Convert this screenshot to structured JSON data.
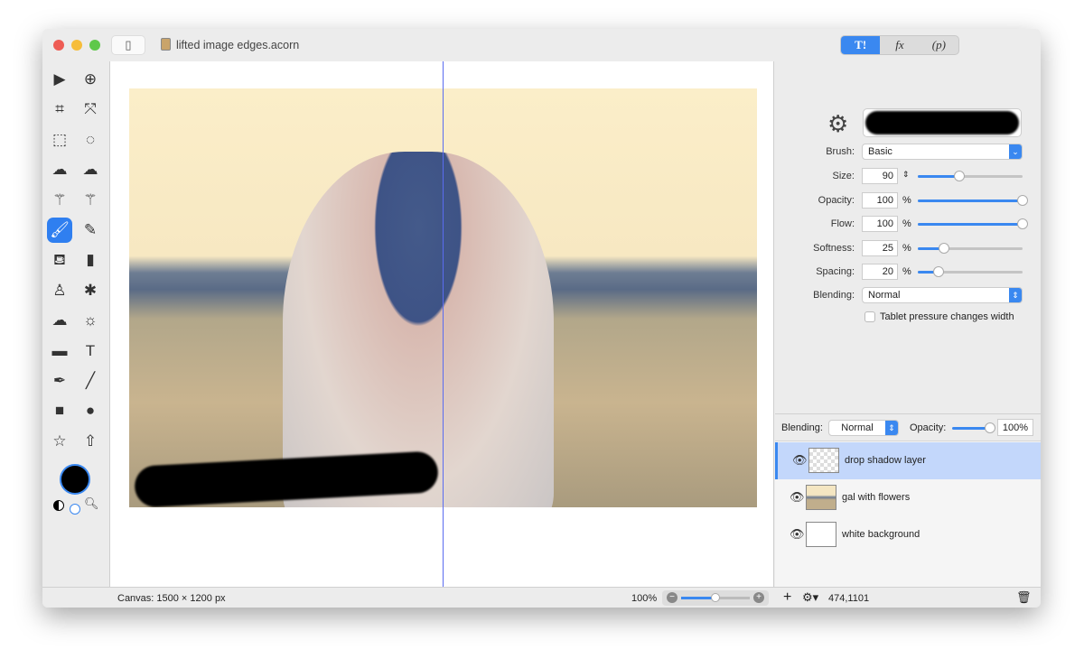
{
  "window": {
    "title": "lifted image edges.acorn",
    "traffic_colors": [
      "#ee5c54",
      "#f6bd3b",
      "#5fc84a"
    ]
  },
  "inspector_tabs": [
    {
      "label": "T!",
      "icon": "tools-icon"
    },
    {
      "label": "fx",
      "icon": "fx-icon"
    },
    {
      "label": "(p)",
      "icon": "properties-icon"
    }
  ],
  "tools": [
    [
      "arrow-icon",
      "▶"
    ],
    [
      "zoom-icon",
      "⊕"
    ],
    [
      "crop-icon",
      "⌗"
    ],
    [
      "transform-icon",
      "⤧"
    ],
    [
      "rect-select-icon",
      "⬚"
    ],
    [
      "ellipse-select-icon",
      "◌"
    ],
    [
      "lasso-icon",
      "☁"
    ],
    [
      "polygon-lasso-icon",
      "☁"
    ],
    [
      "magic-wand-icon",
      "⚚"
    ],
    [
      "color-select-icon",
      "⚚"
    ],
    [
      "brush-icon",
      "🖌"
    ],
    [
      "pencil-icon",
      "✎"
    ],
    [
      "paint-bucket-icon",
      "⛾"
    ],
    [
      "eraser-icon",
      "▮"
    ],
    [
      "clone-stamp-icon",
      "♙"
    ],
    [
      "splatter-icon",
      "✱"
    ],
    [
      "cloud-icon",
      "☁"
    ],
    [
      "sun-icon",
      "☼"
    ],
    [
      "gradient-icon",
      "▬"
    ],
    [
      "text-icon",
      "T"
    ],
    [
      "pen-icon",
      "✒"
    ],
    [
      "line-icon",
      "╱"
    ],
    [
      "rectangle-icon",
      "■"
    ],
    [
      "oval-icon",
      "●"
    ],
    [
      "star-icon",
      "☆"
    ],
    [
      "arrow-shape-icon",
      "⇧"
    ]
  ],
  "brush": {
    "label": "Brush:",
    "value": "Basic"
  },
  "settings": [
    {
      "label": "Size:",
      "value": "90",
      "unit": "",
      "level": 0.4
    },
    {
      "label": "Opacity:",
      "value": "100",
      "unit": "%",
      "level": 1.0
    },
    {
      "label": "Flow:",
      "value": "100",
      "unit": "%",
      "level": 1.0
    },
    {
      "label": "Softness:",
      "value": "25",
      "unit": "%",
      "level": 0.25
    },
    {
      "label": "Spacing:",
      "value": "20",
      "unit": "%",
      "level": 0.2
    }
  ],
  "blending": {
    "label": "Blending:",
    "value": "Normal"
  },
  "tablet": {
    "label": "Tablet pressure changes width",
    "checked": false
  },
  "layers_header": {
    "blending_label": "Blending:",
    "blending_value": "Normal",
    "opacity_label": "Opacity:",
    "opacity_value": "100%",
    "opacity_level": 1.0
  },
  "layers": [
    {
      "name": "drop shadow layer",
      "selected": true
    },
    {
      "name": "gal with flowers",
      "selected": false
    },
    {
      "name": "white background",
      "selected": false
    }
  ],
  "status": {
    "canvas": "Canvas: 1500 × 1200 px",
    "zoom": "100%",
    "zoom_level": 0.5,
    "coords": "474,1101"
  },
  "colors": {
    "accent": "#3a88f0",
    "foreground": "#000000",
    "background": "#ffffff"
  }
}
